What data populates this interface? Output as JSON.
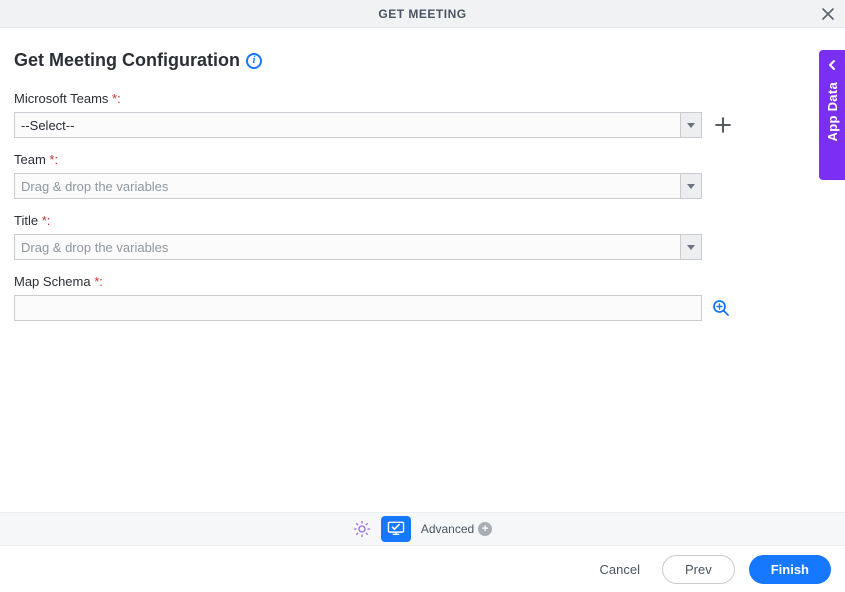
{
  "header": {
    "title": "GET MEETING"
  },
  "page": {
    "title": "Get Meeting Configuration"
  },
  "fields": {
    "teams_connector": {
      "label": "Microsoft Teams ",
      "value": "--Select--"
    },
    "team": {
      "label": "Team ",
      "placeholder": "Drag & drop the variables"
    },
    "title": {
      "label": "Title ",
      "placeholder": "Drag & drop the variables"
    },
    "map_schema": {
      "label": "Map Schema "
    }
  },
  "side_tab": {
    "label": "App Data"
  },
  "toolbar": {
    "advanced_label": "Advanced"
  },
  "footer": {
    "cancel": "Cancel",
    "prev": "Prev",
    "finish": "Finish"
  },
  "symbols": {
    "star_colon": "*:",
    "info": "i"
  }
}
